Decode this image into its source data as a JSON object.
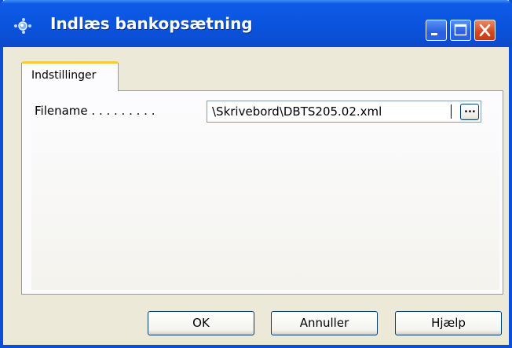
{
  "window": {
    "title": "Indlæs bankopsætning"
  },
  "tabs": [
    {
      "label": "Indstillinger"
    }
  ],
  "form": {
    "filename_label": "Filename . . . . . . . . .",
    "filename_value": "\\Skrivebord\\DBTS205.02.xml",
    "browse_label": "..."
  },
  "buttons": {
    "ok": "OK",
    "cancel": "Annuller",
    "help": "Hjælp"
  },
  "colors": {
    "titlebar": "#0A55E0",
    "frame": "#0A4FD6",
    "face": "#ECE9D8",
    "tab_highlight": "#FFC83C",
    "close": "#D6461E"
  }
}
